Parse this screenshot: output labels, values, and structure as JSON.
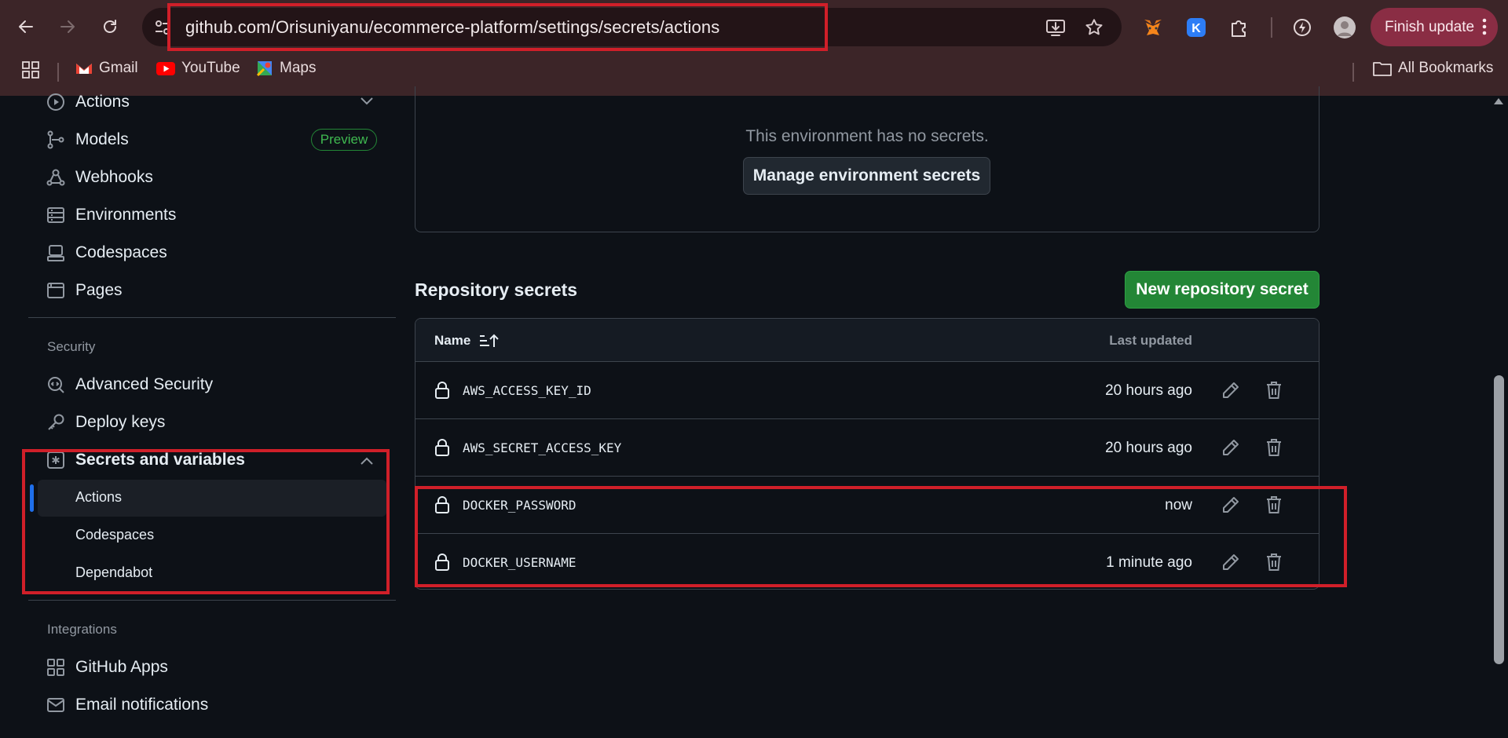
{
  "browser": {
    "url": "github.com/Orisuniyanu/ecommerce-platform/settings/secrets/actions",
    "finish_update_label": "Finish update",
    "bookmarks": [
      {
        "label": "Gmail"
      },
      {
        "label": "YouTube"
      },
      {
        "label": "Maps"
      }
    ],
    "all_bookmarks_label": "All Bookmarks"
  },
  "sidebar": {
    "items_top": [
      {
        "label": "Actions",
        "icon": "play-circle-icon"
      },
      {
        "label": "Models",
        "icon": "models-icon",
        "badge": "Preview"
      },
      {
        "label": "Webhooks",
        "icon": "webhook-icon"
      },
      {
        "label": "Environments",
        "icon": "server-icon"
      },
      {
        "label": "Codespaces",
        "icon": "codespaces-icon"
      },
      {
        "label": "Pages",
        "icon": "browser-icon"
      }
    ],
    "security_heading": "Security",
    "security_items": [
      {
        "label": "Advanced Security",
        "icon": "codescan-icon"
      },
      {
        "label": "Deploy keys",
        "icon": "key-icon"
      },
      {
        "label": "Secrets and variables",
        "icon": "asterisk-icon"
      }
    ],
    "secrets_subitems": [
      {
        "label": "Actions",
        "active": true
      },
      {
        "label": "Codespaces"
      },
      {
        "label": "Dependabot"
      }
    ],
    "integrations_heading": "Integrations",
    "integrations_items": [
      {
        "label": "GitHub Apps",
        "icon": "apps-icon"
      },
      {
        "label": "Email notifications",
        "icon": "mail-icon"
      }
    ]
  },
  "main": {
    "env_empty_text": "This environment has no secrets.",
    "manage_env_button": "Manage environment secrets",
    "repo_secrets_title": "Repository secrets",
    "new_secret_button": "New repository secret",
    "table": {
      "col_name": "Name",
      "col_updated": "Last updated",
      "rows": [
        {
          "name": "AWS_ACCESS_KEY_ID",
          "updated": "20 hours ago"
        },
        {
          "name": "AWS_SECRET_ACCESS_KEY",
          "updated": "20 hours ago"
        },
        {
          "name": "DOCKER_PASSWORD",
          "updated": "now"
        },
        {
          "name": "DOCKER_USERNAME",
          "updated": "1 minute ago"
        }
      ]
    }
  },
  "colors": {
    "chrome_bg": "#3c2528",
    "page_bg": "#0d1117",
    "accent_green": "#238636",
    "annotation_red": "#d01f29",
    "active_blue": "#1f6feb"
  }
}
